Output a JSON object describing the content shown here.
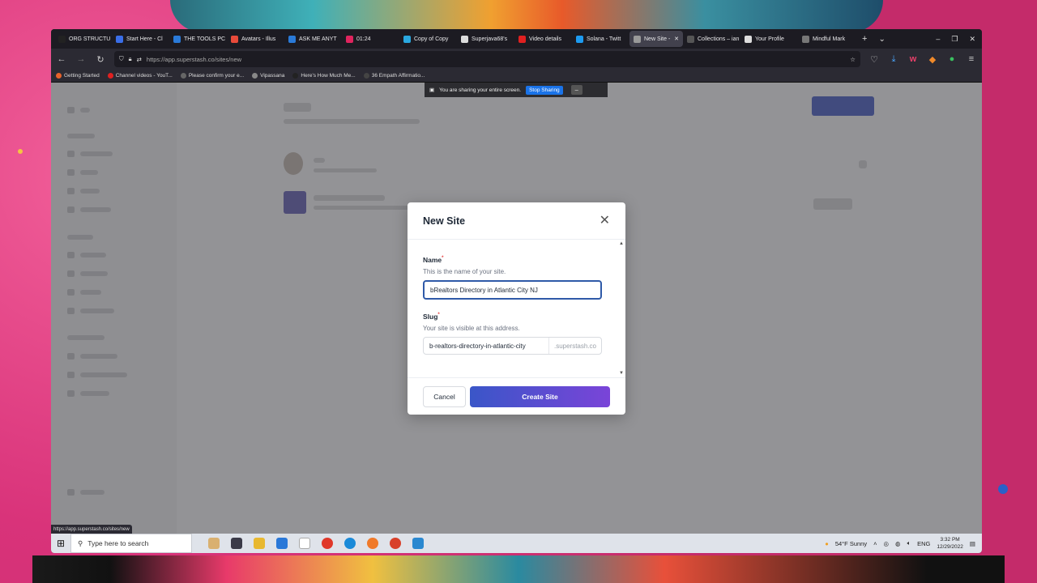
{
  "browser": {
    "tabs": [
      {
        "label": "ORG STRUCTU",
        "color": "#222",
        "active": false
      },
      {
        "label": "Start Here - Cl",
        "color": "#3a6ee8",
        "active": false
      },
      {
        "label": "THE TOOLS PC",
        "color": "#2a7ad8",
        "active": false
      },
      {
        "label": "Avatars - Illus",
        "color": "#e84a3a",
        "active": false
      },
      {
        "label": "ASK ME ANYT",
        "color": "#2a7ad8",
        "active": false
      },
      {
        "label": "01:24",
        "color": "#e0245e",
        "active": false
      },
      {
        "label": "Copy of Copy",
        "color": "#2aa8e0",
        "active": false
      },
      {
        "label": "Superjava68's",
        "color": "#ddd",
        "active": false
      },
      {
        "label": "Video details",
        "color": "#e02020",
        "active": false
      },
      {
        "label": "Solana - Twitt",
        "color": "#1d9bf0",
        "active": false
      },
      {
        "label": "New Site -",
        "color": "#999",
        "active": true
      },
      {
        "label": "Collections – ian",
        "color": "#555",
        "active": false
      },
      {
        "label": "Your Profile",
        "color": "#ddd",
        "active": false
      },
      {
        "label": "Mindful Mark",
        "color": "#777",
        "active": false
      }
    ],
    "url": "https://app.superstash.co/sites/new",
    "bookmarks": [
      {
        "label": "Getting Started",
        "color": "#e8622a"
      },
      {
        "label": "Channel videos - YouT...",
        "color": "#e02020"
      },
      {
        "label": "Please confirm your e...",
        "color": "#666"
      },
      {
        "label": "Vipassana",
        "color": "#888"
      },
      {
        "label": "Here's How Much Me...",
        "color": "#222"
      },
      {
        "label": "36 Empath Affirmatio...",
        "color": "#444"
      }
    ],
    "status_url": "https://app.superstash.co/sites/new"
  },
  "share_bar": {
    "message": "You are sharing your entire screen.",
    "stop_label": "Stop Sharing",
    "min_label": "_"
  },
  "modal": {
    "title": "New Site",
    "close_glyph": "✕",
    "name_label": "Name",
    "name_hint": "This is the name of your site.",
    "name_value": "bRealtors Directory in Atlantic City NJ",
    "slug_label": "Slug",
    "slug_hint": "Your site is visible at this address.",
    "slug_value": "b-realtors-directory-in-atlantic-city",
    "slug_suffix": ".superstash.co",
    "required_mark": "*",
    "cancel_label": "Cancel",
    "create_label": "Create Site"
  },
  "taskbar": {
    "search_placeholder": "Type here to search",
    "weather": "54°F  Sunny",
    "lang": "ENG",
    "time": "3:32 PM",
    "date": "12/29/2022"
  }
}
